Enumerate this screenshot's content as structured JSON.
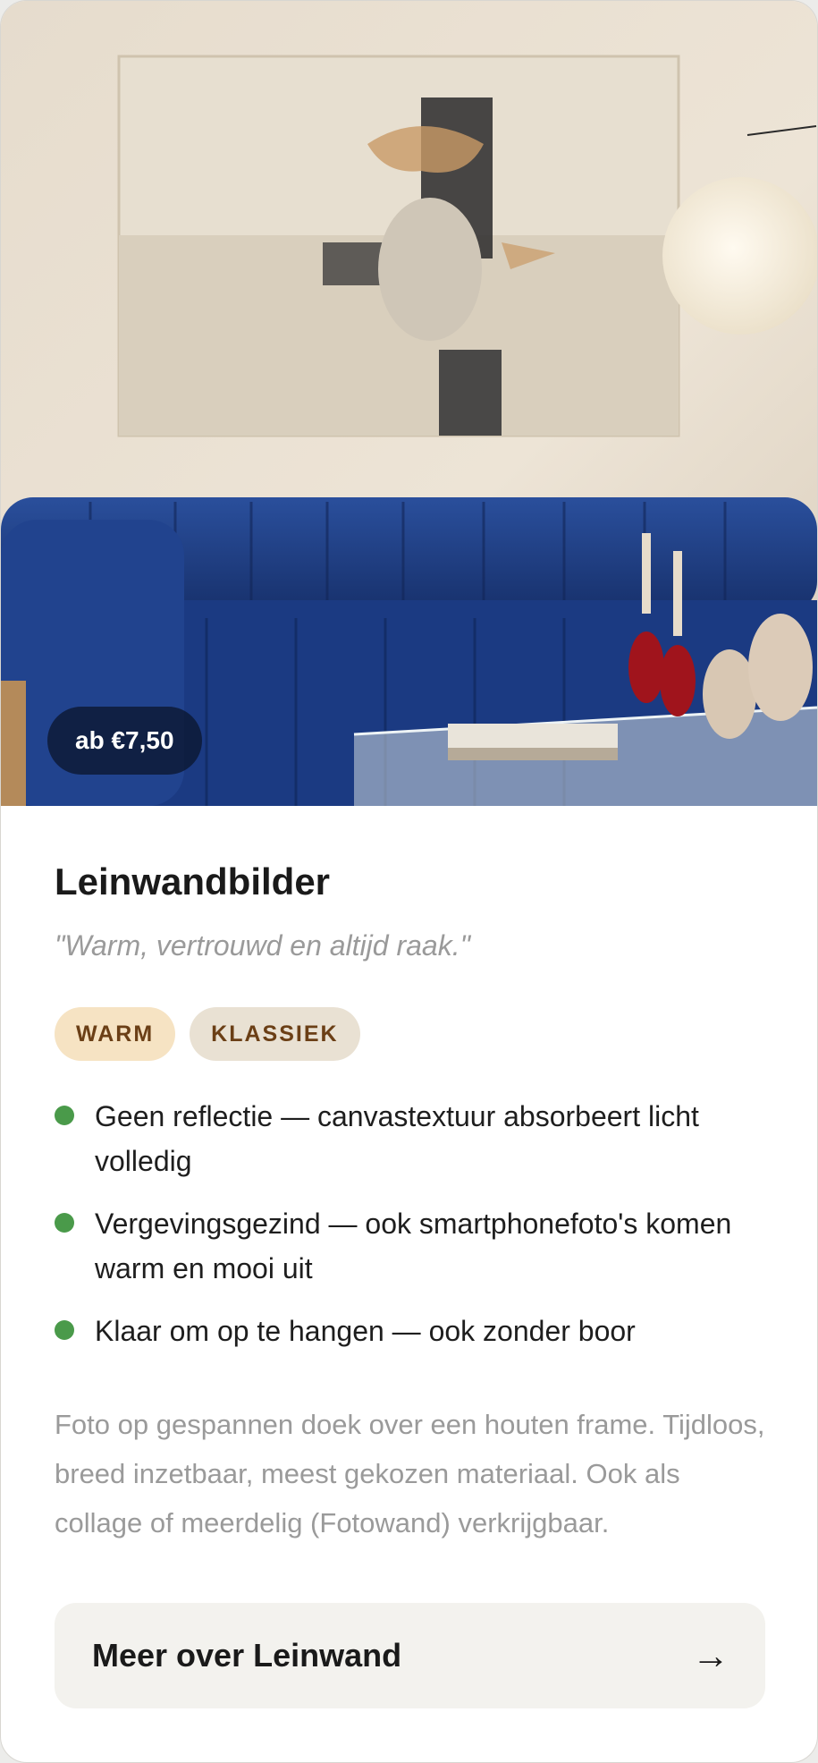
{
  "hero": {
    "image_name": "living-room-canvas-photo",
    "price_badge": "ab €7,50"
  },
  "product": {
    "title": "Leinwandbilder",
    "tagline": "\"Warm, vertrouwd en altijd raak.\"",
    "tags": [
      "WARM",
      "KLASSIEK"
    ],
    "features": [
      "Geen reflectie — canvastextuur absorbeert licht volledig",
      "Vergevingsgezind — ook smartphonefoto's komen warm en mooi uit",
      "Klaar om op te hangen — ook zonder boor"
    ],
    "description": "Foto op gespannen doek over een houten frame. Tijdloos, breed inzetbaar, meest gekozen materiaal. Ook als collage of meerdelig (Fotowand) verkrijgbaar."
  },
  "cta": {
    "label": "Meer over Leinwand",
    "arrow": "→"
  },
  "colors": {
    "bullet": "#4a9a4a",
    "tag_warm_bg": "#f6e3c3",
    "tag_klassiek_bg": "#e9e1d3",
    "tag_text": "#6b3f16",
    "cta_bg": "#f3f2ee",
    "sofa": "#1f3f86"
  }
}
